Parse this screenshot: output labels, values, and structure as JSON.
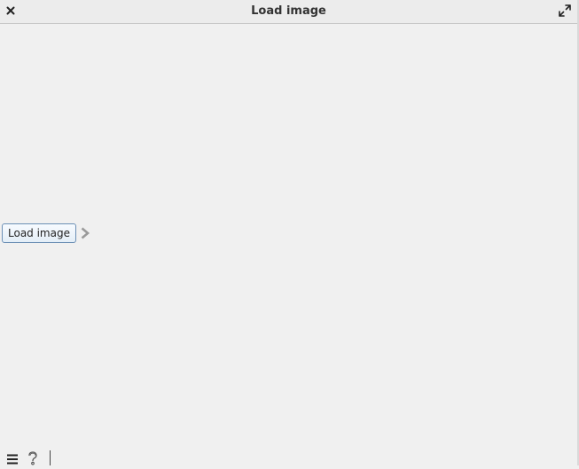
{
  "window": {
    "title": "Load image"
  },
  "titlebar": {
    "close_icon": "close-icon",
    "maximize_icon": "maximize-icon"
  },
  "main": {
    "load_button_label": "Load image",
    "arrow_icon": "chevron-right-icon"
  },
  "bottombar": {
    "menu_icon": "hamburger-menu-icon",
    "help_icon": "help-icon"
  },
  "colors": {
    "background": "#f0f0f0",
    "button_border": "#6b8fb5",
    "arrow": "#9a9a9a"
  }
}
